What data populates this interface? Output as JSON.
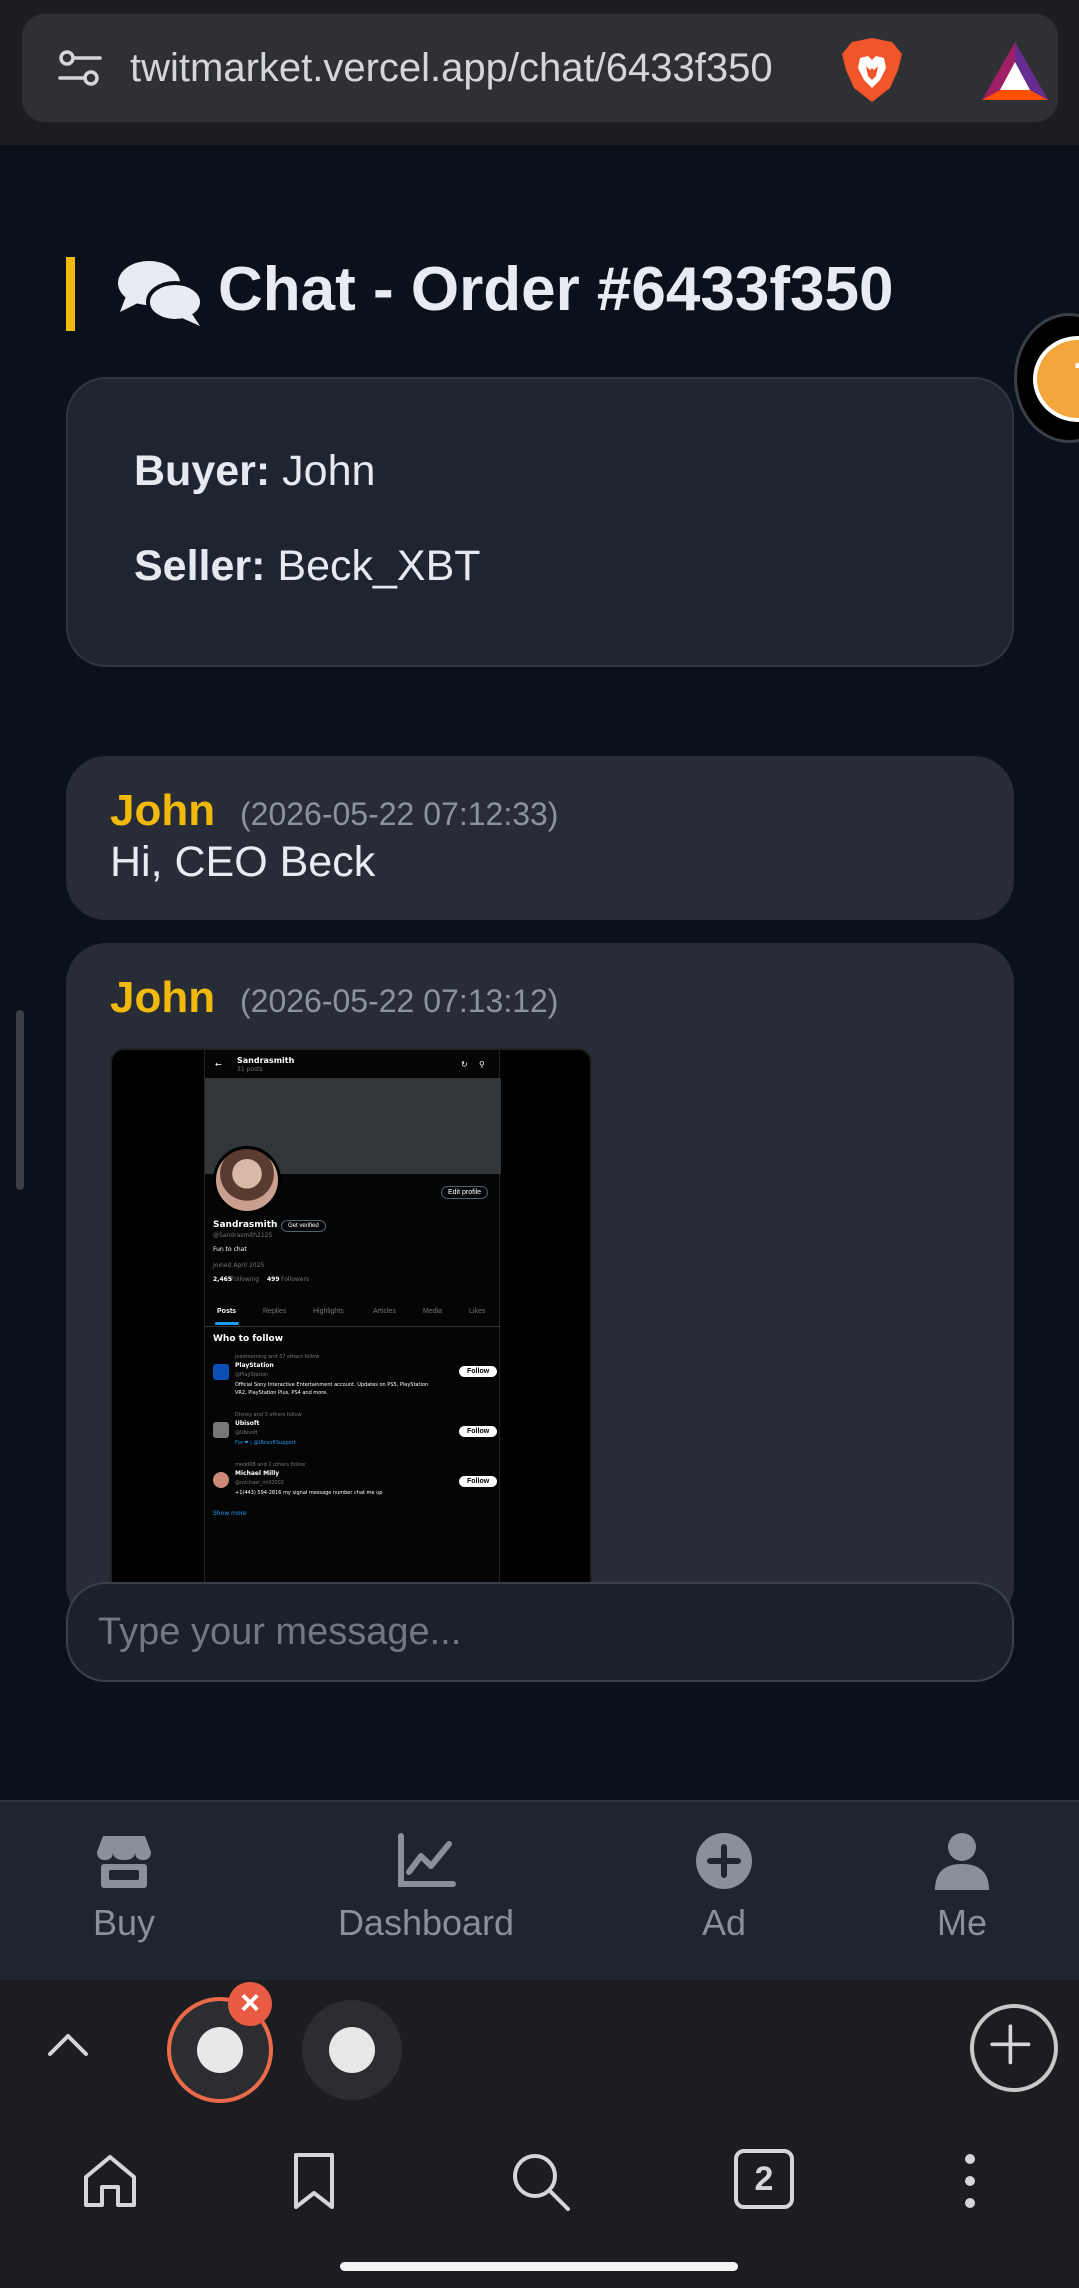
{
  "browser": {
    "url": "twitmarket.vercel.app/chat/6433f350",
    "tab_count": "2"
  },
  "page": {
    "title": "Chat - Order #6433f350",
    "buyer_label": "Buyer:",
    "buyer_name": "John",
    "seller_label": "Seller:",
    "seller_name": "Beck_XBT"
  },
  "messages": [
    {
      "sender": "John",
      "time": "(2026-05-22 07:12:33)",
      "text": "Hi, CEO Beck"
    },
    {
      "sender": "John",
      "time": "(2026-05-22 07:13:12)",
      "text": ""
    }
  ],
  "attachment": {
    "header_name": "Sandrasmith",
    "header_posts": "31 posts",
    "edit_profile": "Edit profile",
    "display_name": "Sandrasmith",
    "get_verified": "Get verified",
    "handle": "@Sandrasmith2125",
    "bio": "Fun to chat",
    "joined": "Joined April 2025",
    "following_count": "2,465",
    "following_label": "Following",
    "followers_count": "499",
    "followers_label": "Followers",
    "tabs": [
      "Posts",
      "Replies",
      "Highlights",
      "Articles",
      "Media",
      "Likes"
    ],
    "who_to_follow": "Who to follow",
    "suggestions": [
      {
        "context": "joedmorning and 37 others follow",
        "name": "PlayStation",
        "handle": "@PlayStation",
        "desc1": "Official Sony Interactive Entertainment account. Updates on PS5, PlayStation",
        "desc2": "VR2, PlayStation Plus, PS4 and more.",
        "button": "Follow"
      },
      {
        "context": "Disney and 3 others follow",
        "name": "Ubisoft",
        "handle": "@Ubisoft",
        "desc1": "For ❤ | @UbisoftSupport",
        "desc2": "",
        "button": "Follow"
      },
      {
        "context": "medd08 and 2 others follow",
        "name": "Michael Milly",
        "handle": "@michael_mill2002",
        "desc1": "+1(443) 594-2816 my signal message number chat me up",
        "desc2": "",
        "button": "Follow"
      }
    ],
    "show_more": "Show more"
  },
  "input": {
    "placeholder": "Type your message..."
  },
  "app_nav": [
    {
      "label": "Buy",
      "icon": "store-icon"
    },
    {
      "label": "Dashboard",
      "icon": "chart-line-icon"
    },
    {
      "label": "Ad",
      "icon": "plus-circle-icon"
    },
    {
      "label": "Me",
      "icon": "user-icon"
    }
  ],
  "colors": {
    "accent": "#f0b90b",
    "background": "#0b111a",
    "card": "#272c37"
  }
}
